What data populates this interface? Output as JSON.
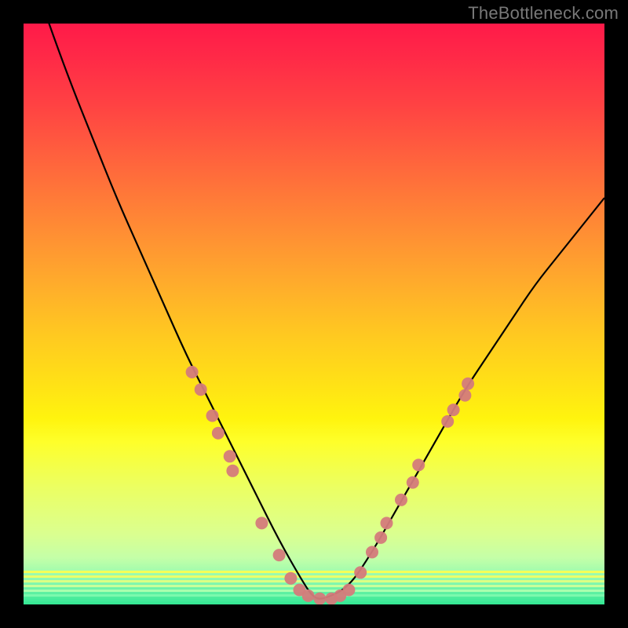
{
  "watermark": "TheBottleneck.com",
  "chart_data": {
    "type": "line",
    "title": "",
    "xlabel": "",
    "ylabel": "",
    "xlim": [
      0,
      100
    ],
    "ylim": [
      0,
      100
    ],
    "grid": false,
    "background": "vertical_gradient_red_to_green",
    "series": [
      {
        "name": "curve",
        "color": "#000000",
        "x": [
          0,
          4,
          8,
          12,
          16,
          20,
          24,
          28,
          32,
          36,
          40,
          44,
          48,
          50,
          52,
          56,
          60,
          64,
          68,
          72,
          76,
          80,
          84,
          88,
          92,
          96,
          100
        ],
        "values": [
          113,
          101,
          90,
          80,
          70,
          61,
          52,
          43,
          35,
          27,
          19,
          11,
          4,
          1,
          1,
          3,
          9,
          16,
          23,
          30,
          37,
          43,
          49,
          55,
          60,
          65,
          70
        ]
      },
      {
        "name": "dots",
        "color": "#d47b7b",
        "points": [
          {
            "x": 29.0,
            "y": 40.0
          },
          {
            "x": 30.5,
            "y": 37.0
          },
          {
            "x": 32.5,
            "y": 32.5
          },
          {
            "x": 33.5,
            "y": 29.5
          },
          {
            "x": 35.5,
            "y": 25.5
          },
          {
            "x": 36.0,
            "y": 23.0
          },
          {
            "x": 41.0,
            "y": 14.0
          },
          {
            "x": 44.0,
            "y": 8.5
          },
          {
            "x": 46.0,
            "y": 4.5
          },
          {
            "x": 47.5,
            "y": 2.5
          },
          {
            "x": 49.0,
            "y": 1.5
          },
          {
            "x": 51.0,
            "y": 1.0
          },
          {
            "x": 53.0,
            "y": 1.0
          },
          {
            "x": 54.5,
            "y": 1.5
          },
          {
            "x": 56.0,
            "y": 2.5
          },
          {
            "x": 58.0,
            "y": 5.5
          },
          {
            "x": 60.0,
            "y": 9.0
          },
          {
            "x": 61.5,
            "y": 11.5
          },
          {
            "x": 62.5,
            "y": 14.0
          },
          {
            "x": 65.0,
            "y": 18.0
          },
          {
            "x": 67.0,
            "y": 21.0
          },
          {
            "x": 68.0,
            "y": 24.0
          },
          {
            "x": 73.0,
            "y": 31.5
          },
          {
            "x": 74.0,
            "y": 33.5
          },
          {
            "x": 76.0,
            "y": 36.0
          },
          {
            "x": 76.5,
            "y": 38.0
          }
        ]
      }
    ]
  }
}
